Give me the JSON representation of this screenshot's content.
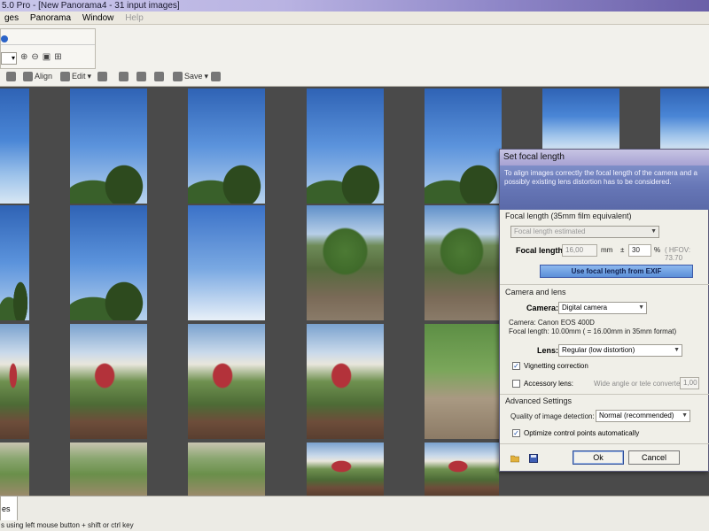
{
  "window": {
    "title": "5.0 Pro - [New Panorama4 - 31 input images]"
  },
  "menu": [
    {
      "label": "ges",
      "disabled": false
    },
    {
      "label": "Panorama",
      "disabled": false
    },
    {
      "label": "Window",
      "disabled": false
    },
    {
      "label": "Help",
      "disabled": true
    }
  ],
  "toolbar": {
    "zoom_value": "",
    "align_label": "Align",
    "edit_label": "Edit",
    "save_label": "Save"
  },
  "dialog": {
    "title": "Set focal length",
    "banner_text": "To align images correctly the focal length of the camera and a possibly existing lens distortion has to be considered.",
    "focal_section_label": "Focal length (35mm film equivalent)",
    "focal_mode": "Focal length estimated",
    "focal_length_label": "Focal length:",
    "focal_value": "16,00",
    "focal_unit": "mm",
    "plusminus": "±",
    "tolerance_value": "30",
    "percent": "%",
    "hfov_text": "( HFOV: 73.70",
    "exif_button": "Use focal length from EXIF",
    "camera_section_label": "Camera and lens",
    "camera_label": "Camera:",
    "camera_value": "Digital camera",
    "camera_info": "Camera: Canon EOS 400D",
    "focal_info": "Focal length: 10.00mm ( = 16.00mm in 35mm format)",
    "lens_label": "Lens:",
    "lens_value": "Regular  (low distortion)",
    "vignetting_label": "Vignetting correction",
    "vignetting_checked": true,
    "accessory_label": "Accessory lens:",
    "accessory_checked": false,
    "converter_label": "Wide angle or tele converter",
    "converter_value": "1,00",
    "advanced_section_label": "Advanced Settings",
    "quality_label": "Quality of image detection:",
    "quality_value": "Normal (recommended)",
    "optimize_label": "Optimize control points automatically",
    "optimize_checked": true,
    "ok_button": "Ok",
    "cancel_button": "Cancel"
  },
  "tabs": [
    {
      "label": "es"
    }
  ],
  "status": {
    "text": "s using left mouse button + shift or ctrl key"
  },
  "colors": {
    "accent": "#5b8fd8",
    "dialog_banner": "#6676b6",
    "grid_bg": "#4a4a4a"
  }
}
